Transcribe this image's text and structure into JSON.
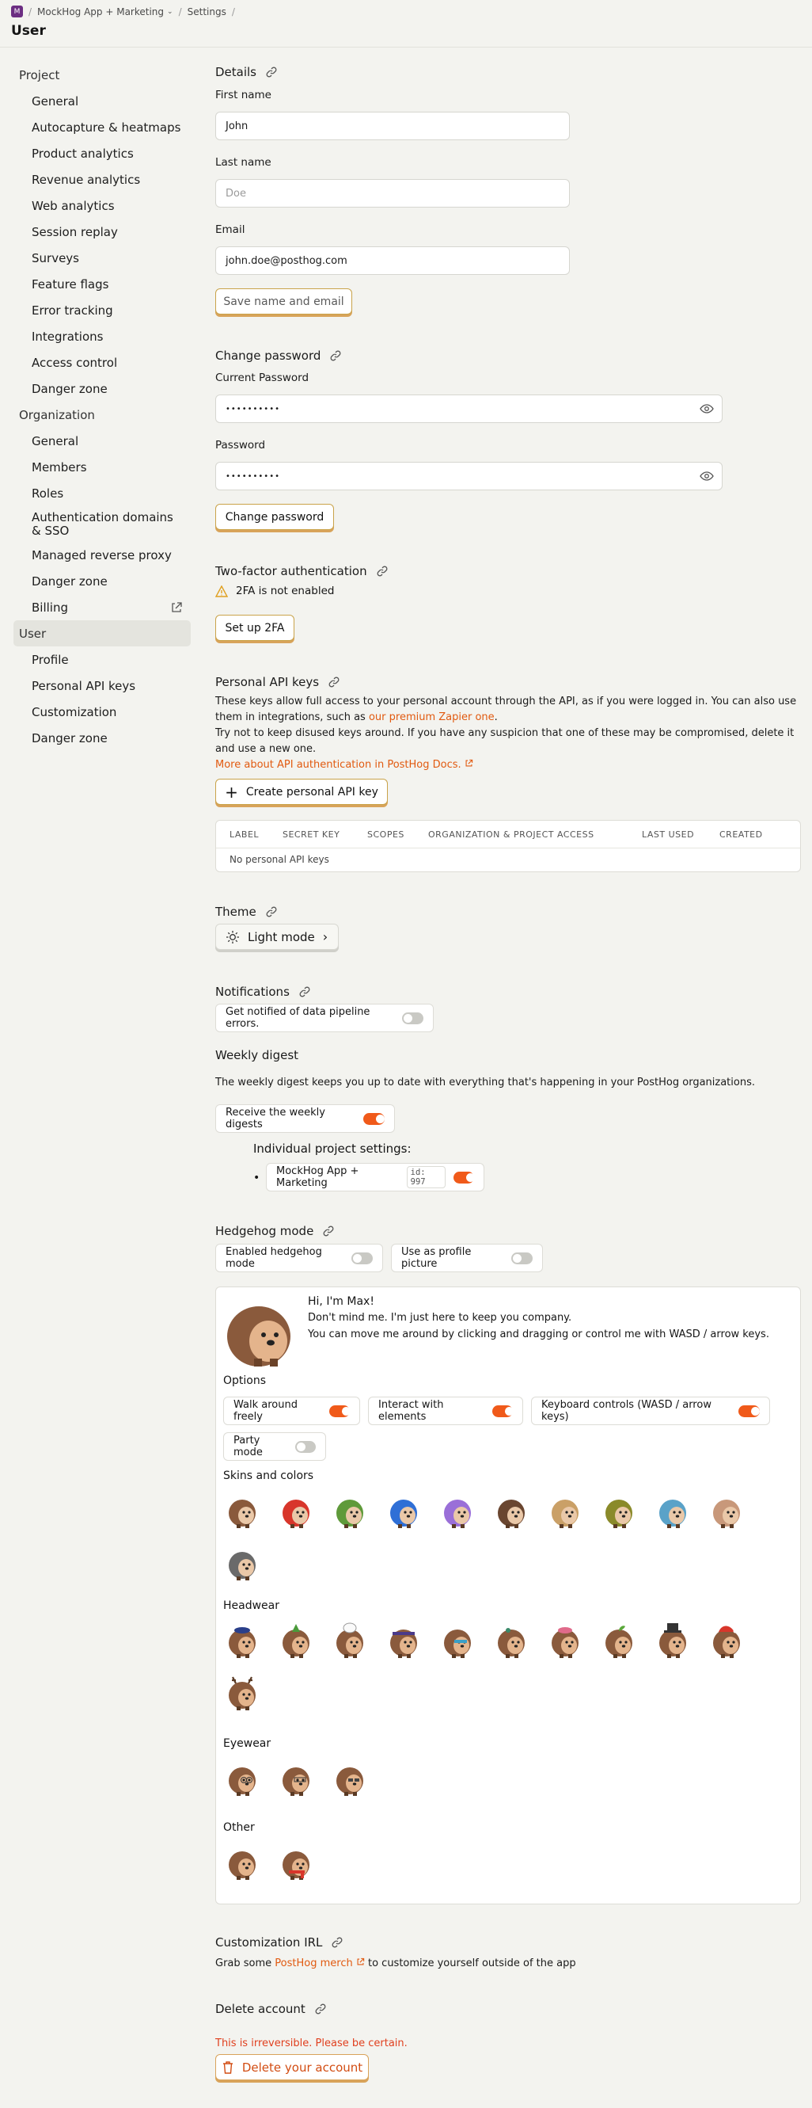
{
  "breadcrumb": {
    "org_initial": "M",
    "project": "MockHog App + Marketing",
    "section": "Settings"
  },
  "page_title": "User",
  "sidebar": {
    "project_title": "Project",
    "project_items": [
      {
        "label": "General"
      },
      {
        "label": "Autocapture & heatmaps"
      },
      {
        "label": "Product analytics"
      },
      {
        "label": "Revenue analytics"
      },
      {
        "label": "Web analytics"
      },
      {
        "label": "Session replay"
      },
      {
        "label": "Surveys"
      },
      {
        "label": "Feature flags"
      },
      {
        "label": "Error tracking"
      },
      {
        "label": "Integrations"
      },
      {
        "label": "Access control"
      },
      {
        "label": "Danger zone"
      }
    ],
    "organization_title": "Organization",
    "organization_items": [
      {
        "label": "General"
      },
      {
        "label": "Members"
      },
      {
        "label": "Roles"
      },
      {
        "label": "Authentication domains & SSO"
      },
      {
        "label": "Managed reverse proxy"
      },
      {
        "label": "Danger zone"
      },
      {
        "label": "Billing"
      }
    ],
    "user_title": "User",
    "user_items": [
      {
        "label": "Profile"
      },
      {
        "label": "Personal API keys"
      },
      {
        "label": "Customization"
      },
      {
        "label": "Danger zone"
      }
    ]
  },
  "details": {
    "title": "Details",
    "first_name_label": "First name",
    "first_name_value": "John",
    "last_name_label": "Last name",
    "last_name_placeholder": "Doe",
    "email_label": "Email",
    "email_value": "john.doe@posthog.com",
    "save_label": "Save name and email"
  },
  "password": {
    "title": "Change password",
    "current_label": "Current Password",
    "current_value": "••••••••••",
    "new_label": "Password",
    "new_value": "••••••••••",
    "button": "Change password"
  },
  "twofa": {
    "title": "Two-factor authentication",
    "status": "2FA is not enabled",
    "button": "Set up 2FA"
  },
  "api_keys": {
    "title": "Personal API keys",
    "desc1_a": "These keys allow full access to your personal account through the API, as if you were logged in. You can also use them in integrations, such as ",
    "desc1_link": "our premium Zapier one",
    "desc1_b": ".",
    "desc2": "Try not to keep disused keys around. If you have any suspicion that one of these may be compromised, delete it and use a new one.",
    "docs_link": "More about API authentication in PostHog Docs.",
    "create_button": "Create personal API key",
    "columns": [
      "LABEL",
      "SECRET KEY",
      "SCOPES",
      "ORGANIZATION & PROJECT ACCESS",
      "LAST USED",
      "CREATED"
    ],
    "empty": "No personal API keys"
  },
  "theme": {
    "title": "Theme",
    "value": "Light mode"
  },
  "notifications": {
    "title": "Notifications",
    "pipeline_label": "Get notified of data pipeline errors.",
    "pipeline_on": false,
    "weekly_title": "Weekly digest",
    "weekly_desc": "The weekly digest keeps you up to date with everything that's happening in your PostHog organizations.",
    "weekly_label": "Receive the weekly digests",
    "weekly_on": true,
    "individual_title": "Individual project settings:",
    "project_name": "MockHog App + Marketing",
    "project_id": "id: 997",
    "project_on": true
  },
  "hedgehog": {
    "title": "Hedgehog mode",
    "enabled_label": "Enabled hedgehog mode",
    "enabled_on": false,
    "profile_label": "Use as profile picture",
    "profile_on": false,
    "greeting": "Hi, I'm Max!",
    "line1": "Don't mind me. I'm just here to keep you company.",
    "line2": "You can move me around by clicking and dragging or control me with WASD / arrow keys.",
    "options_title": "Options",
    "options": [
      {
        "label": "Walk around freely",
        "on": true
      },
      {
        "label": "Interact with elements",
        "on": true
      },
      {
        "label": "Keyboard controls (WASD / arrow keys)",
        "on": true
      },
      {
        "label": "Party mode",
        "on": false
      }
    ],
    "skins_title": "Skins and colors",
    "skins": [
      "#8a5a3c",
      "#d8362b",
      "#5f9a3a",
      "#2f6fd6",
      "#9a6fd8",
      "#6a4630",
      "#caa067",
      "#8a8a2a",
      "#5aa2c8",
      "#c8987a",
      "#6a6a6a"
    ],
    "headwear_title": "Headwear",
    "headwear": [
      "beret",
      "green-party-hat",
      "chef-hat",
      "bandana",
      "sunglasses-hat",
      "flower-hat",
      "pink-cap",
      "sprout",
      "top-hat",
      "santa-hat",
      "antlers"
    ],
    "eyewear_title": "Eyewear",
    "eyewear": [
      "glasses",
      "round-glasses",
      "aviator"
    ],
    "other_title": "Other",
    "other": [
      "none",
      "scarf"
    ]
  },
  "irl": {
    "title": "Customization IRL",
    "text_a": "Grab some ",
    "link": "PostHog merch",
    "text_b": " to customize yourself outside of the app"
  },
  "delete": {
    "title": "Delete account",
    "warning": "This is irreversible. Please be certain.",
    "button": "Delete your account"
  },
  "colors": {
    "accent": "#f05a1a",
    "button_border": "#c9a34a",
    "danger": "#e0401f",
    "background": "#f3f3ef"
  }
}
